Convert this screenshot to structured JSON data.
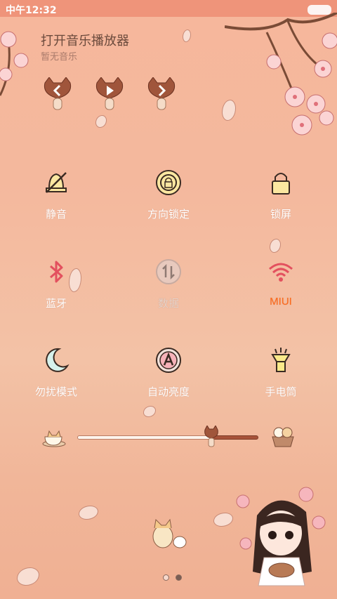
{
  "status": {
    "time": "中午12:32"
  },
  "music": {
    "title": "打开音乐播放器",
    "subtitle": "暂无音乐",
    "controls": [
      {
        "name": "previous-button",
        "icon": "chevron-left-icon"
      },
      {
        "name": "play-button",
        "icon": "play-icon"
      },
      {
        "name": "next-button",
        "icon": "chevron-right-icon"
      }
    ]
  },
  "toggles": {
    "mute": {
      "label": "静音",
      "icon": "bell-off-icon"
    },
    "rotation_lock": {
      "label": "方向锁定",
      "icon": "rotation-lock-icon"
    },
    "lock_screen": {
      "label": "锁屏",
      "icon": "padlock-icon"
    },
    "bluetooth": {
      "label": "蓝牙",
      "icon": "bluetooth-icon"
    },
    "data": {
      "label": "数据",
      "icon": "data-transfer-icon"
    },
    "wifi": {
      "label": "MIUI",
      "icon": "wifi-icon"
    },
    "dnd": {
      "label": "勿扰模式",
      "icon": "moon-icon"
    },
    "auto_brightness": {
      "label": "自动亮度",
      "icon": "auto-a-icon"
    },
    "flashlight": {
      "label": "手电筒",
      "icon": "flashlight-icon"
    }
  },
  "brightness": {
    "level": 0.72
  },
  "pager": {
    "pages": 2,
    "current": 2
  },
  "colors": {
    "accent": "#ff6a1a",
    "text": "#ffffff",
    "background": "#f4b89d"
  }
}
